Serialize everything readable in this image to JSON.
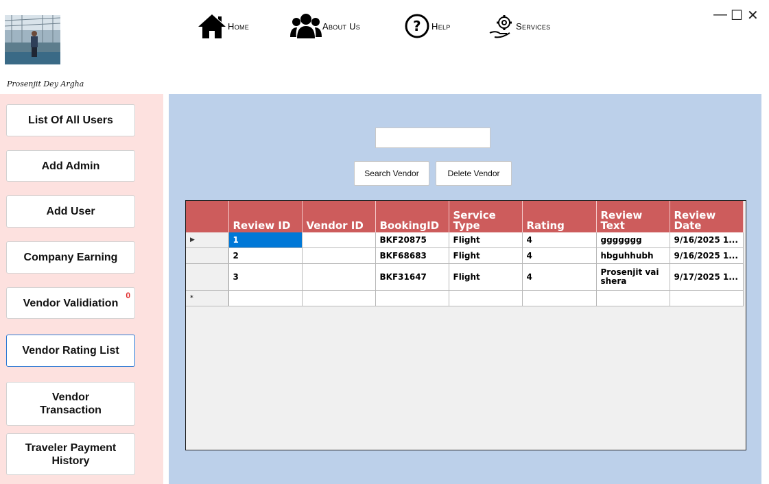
{
  "user": {
    "name": "Prosenjit Dey Argha"
  },
  "nav": [
    {
      "label": "Home",
      "icon": "home-icon"
    },
    {
      "label": "About Us",
      "icon": "users-icon"
    },
    {
      "label": "Help",
      "icon": "help-icon"
    },
    {
      "label": "Services",
      "icon": "services-icon"
    }
  ],
  "window": {
    "minimize": "—",
    "maximize": "☐",
    "close": "✕"
  },
  "sidebar": {
    "items": [
      {
        "label": "List Of All Users"
      },
      {
        "label": "Add Admin"
      },
      {
        "label": "Add User"
      },
      {
        "label": "Company Earning"
      },
      {
        "label": "Vendor Validiation",
        "badge": "0"
      },
      {
        "label": "Vendor Rating List",
        "active": true
      },
      {
        "label": "Vendor Transaction"
      },
      {
        "label": "Traveler Payment History"
      }
    ]
  },
  "search": {
    "value": ""
  },
  "actions": {
    "search_label": "Search Vendor",
    "delete_label": "Delete Vendor"
  },
  "grid": {
    "columns": [
      "Review ID",
      "Vendor ID",
      "BookingID",
      "Service Type",
      "Rating",
      "Review Text",
      "Review Date"
    ],
    "rows": [
      [
        "1",
        "",
        "BKF20875",
        "Flight",
        "4",
        "ggggggg",
        "9/16/2025 1..."
      ],
      [
        "2",
        "",
        "BKF68683",
        "Flight",
        "4",
        "hbguhhubh",
        "9/16/2025 1..."
      ],
      [
        "3",
        "",
        "BKF31647",
        "Flight",
        "4",
        "Prosenjit vai shera",
        "9/17/2025 1..."
      ]
    ],
    "current_row_marker": "▶",
    "new_row_marker": "*"
  },
  "colors": {
    "sidebar_bg": "#fde1df",
    "main_bg": "#bcd0ea",
    "header_bg": "#cd5c5c",
    "selection": "#0078d7"
  }
}
